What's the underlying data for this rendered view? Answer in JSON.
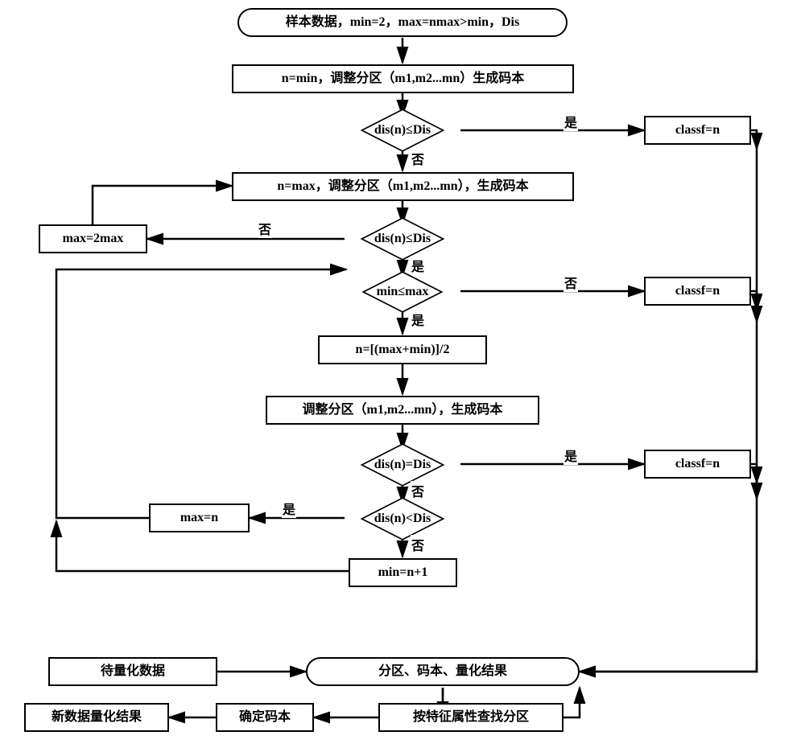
{
  "start": "样本数据，min=2，max=nmax>min，Dis",
  "p1": "n=min，调整分区（m1,m2...mn）生成码本",
  "d1": "dis(n)≤Dis",
  "r1": "classf=n",
  "p2": "n=max，调整分区（m1,m2...mn），生成码本",
  "d2": "dis(n)≤Dis",
  "maxdbl": "max=2max",
  "d3": "min≤max",
  "r2": "classf=n",
  "p3": "n=[(max+min)]/2",
  "p4": "调整分区（m1,m2...mn），生成码本",
  "d4": "dis(n)=Dis",
  "r3": "classf=n",
  "d5": "dis(n)<Dis",
  "maxn": "max=n",
  "minn": "min=n+1",
  "dataq": "待量化数据",
  "out": "分区、码本、量化结果",
  "newres": "新数据量化结果",
  "det": "确定码本",
  "find": "按特征属性查找分区",
  "yes": "是",
  "no": "否"
}
